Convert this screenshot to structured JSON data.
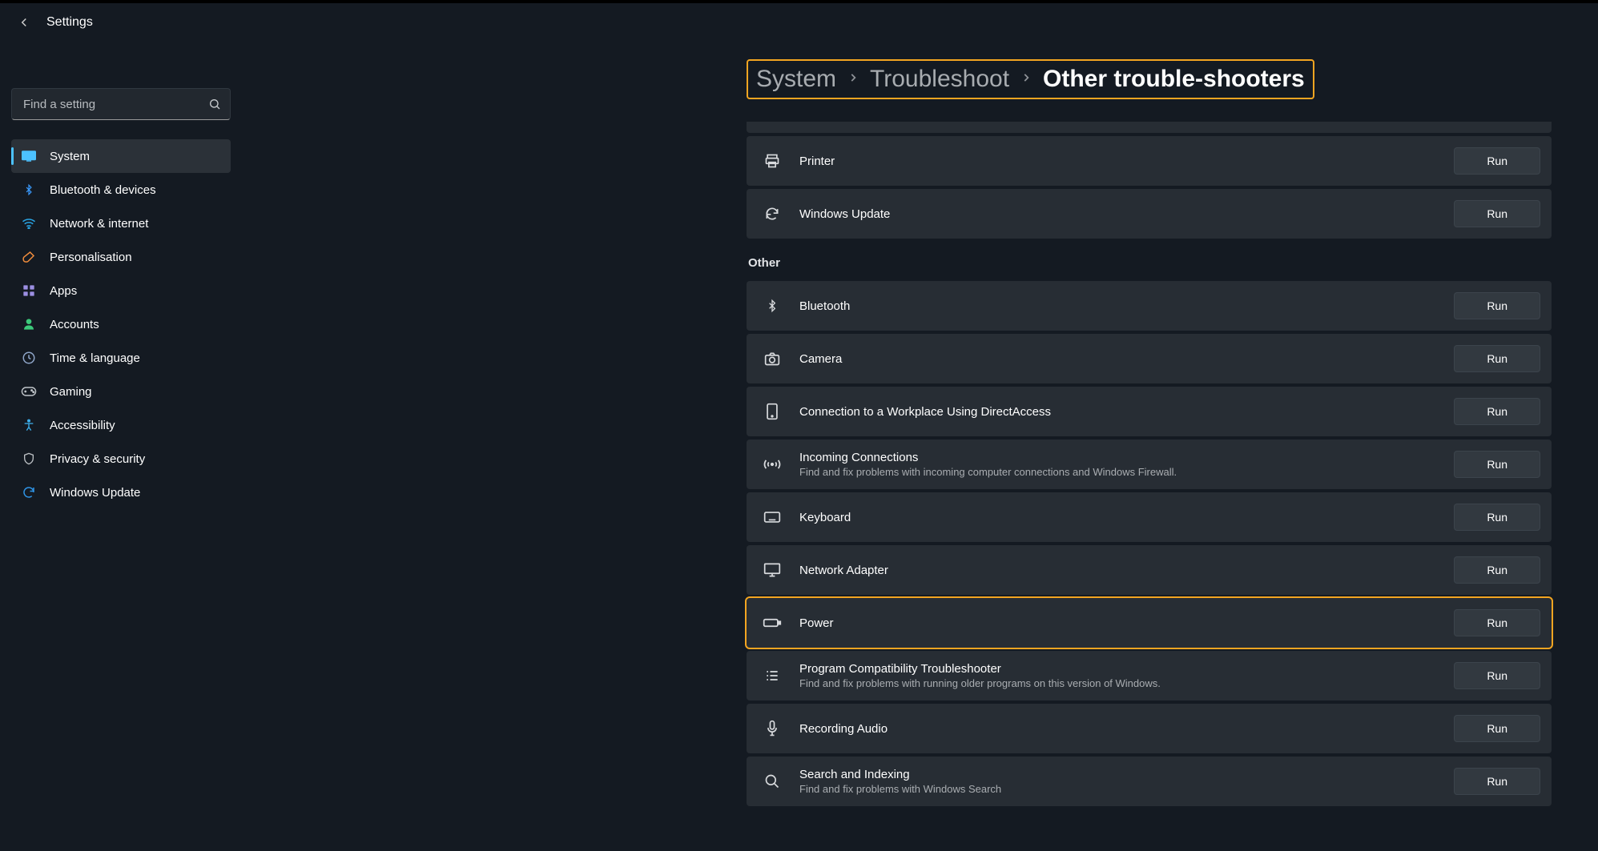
{
  "header": {
    "title": "Settings"
  },
  "search": {
    "placeholder": "Find a setting"
  },
  "sidebar": {
    "items": [
      {
        "label": "System"
      },
      {
        "label": "Bluetooth & devices"
      },
      {
        "label": "Network & internet"
      },
      {
        "label": "Personalisation"
      },
      {
        "label": "Apps"
      },
      {
        "label": "Accounts"
      },
      {
        "label": "Time & language"
      },
      {
        "label": "Gaming"
      },
      {
        "label": "Accessibility"
      },
      {
        "label": "Privacy & security"
      },
      {
        "label": "Windows Update"
      }
    ]
  },
  "breadcrumb": {
    "system": "System",
    "troubleshoot": "Troubleshoot",
    "current": "Other trouble-shooters"
  },
  "run_label": "Run",
  "section_other": "Other",
  "ts": {
    "printer": {
      "title": "Printer"
    },
    "wu": {
      "title": "Windows Update"
    },
    "bt": {
      "title": "Bluetooth"
    },
    "camera": {
      "title": "Camera"
    },
    "da": {
      "title": "Connection to a Workplace Using DirectAccess"
    },
    "incoming": {
      "title": "Incoming Connections",
      "sub": "Find and fix problems with incoming computer connections and Windows Firewall."
    },
    "keyboard": {
      "title": "Keyboard"
    },
    "netadapter": {
      "title": "Network Adapter"
    },
    "power": {
      "title": "Power"
    },
    "compat": {
      "title": "Program Compatibility Troubleshooter",
      "sub": "Find and fix problems with running older programs on this version of Windows."
    },
    "recaudio": {
      "title": "Recording Audio"
    },
    "search": {
      "title": "Search and Indexing",
      "sub": "Find and fix problems with Windows Search"
    }
  }
}
